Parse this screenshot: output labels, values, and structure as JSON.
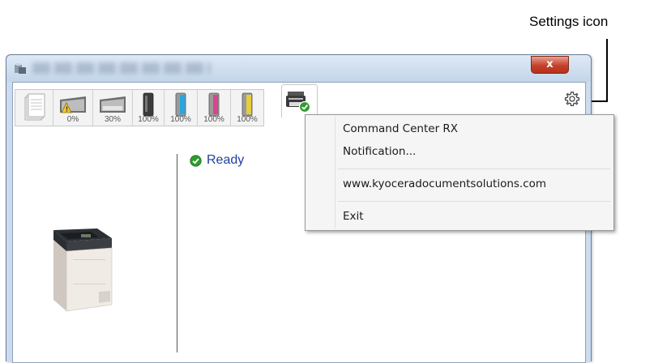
{
  "annotation": {
    "label": "Settings icon"
  },
  "window": {
    "close_glyph": "x",
    "title_blurred": true
  },
  "status_strip": {
    "items": [
      {
        "icon": "paper-stack-icon",
        "percent": ""
      },
      {
        "icon": "tray-warning-icon",
        "percent": "0%"
      },
      {
        "icon": "tray-icon",
        "percent": "30%"
      },
      {
        "icon": "toner-black-icon",
        "percent": "100%",
        "color": "#333333"
      },
      {
        "icon": "toner-cyan-icon",
        "percent": "100%",
        "color": "#2aa6dd"
      },
      {
        "icon": "toner-magenta-icon",
        "percent": "100%",
        "color": "#d9458f"
      },
      {
        "icon": "toner-yellow-icon",
        "percent": "100%",
        "color": "#e8cf3a"
      }
    ]
  },
  "status": {
    "text": "Ready",
    "icon": "check-circle-icon",
    "color": "#1f3f9e"
  },
  "menu": {
    "items": [
      "Command Center RX",
      "Notification...",
      "www.kyoceradocumentsolutions.com",
      "Exit"
    ]
  }
}
